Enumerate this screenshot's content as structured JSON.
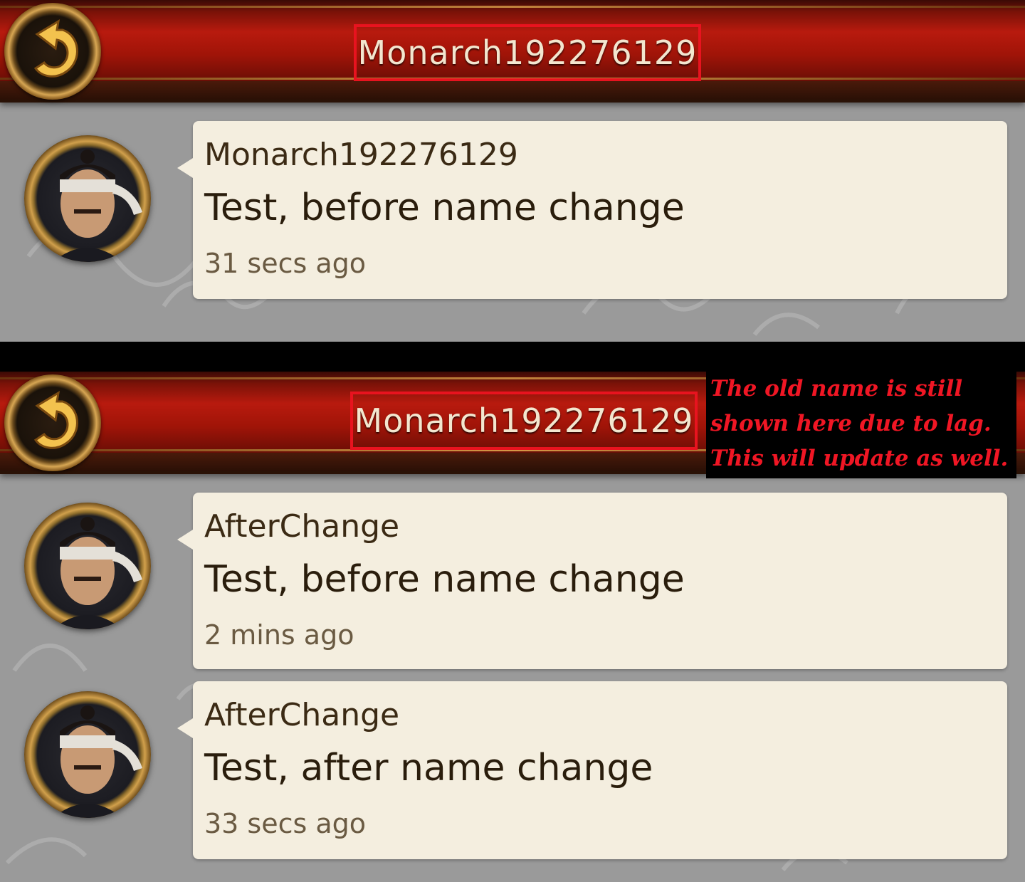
{
  "screens": [
    {
      "header": {
        "title": "Monarch192276129",
        "back_icon": "back-arrow-icon"
      },
      "messages": [
        {
          "sender": "Monarch192276129",
          "text": "Test, before name change",
          "time": "31 secs ago"
        }
      ]
    },
    {
      "header": {
        "title": "Monarch192276129",
        "back_icon": "back-arrow-icon"
      },
      "messages": [
        {
          "sender": "AfterChange",
          "text": "Test, before name change",
          "time": "2 mins ago"
        },
        {
          "sender": "AfterChange",
          "text": "Test, after name change",
          "time": "33 secs ago"
        }
      ]
    }
  ],
  "annotation": {
    "lines": [
      "The old name is still",
      "shown here due to lag.",
      "This will update as well."
    ],
    "color": "#f01624"
  },
  "colors": {
    "highlight_box": "#e8131f",
    "bubble": "#f4eedf",
    "header_red": "#b81a0e",
    "background": "#9a9a9a"
  }
}
